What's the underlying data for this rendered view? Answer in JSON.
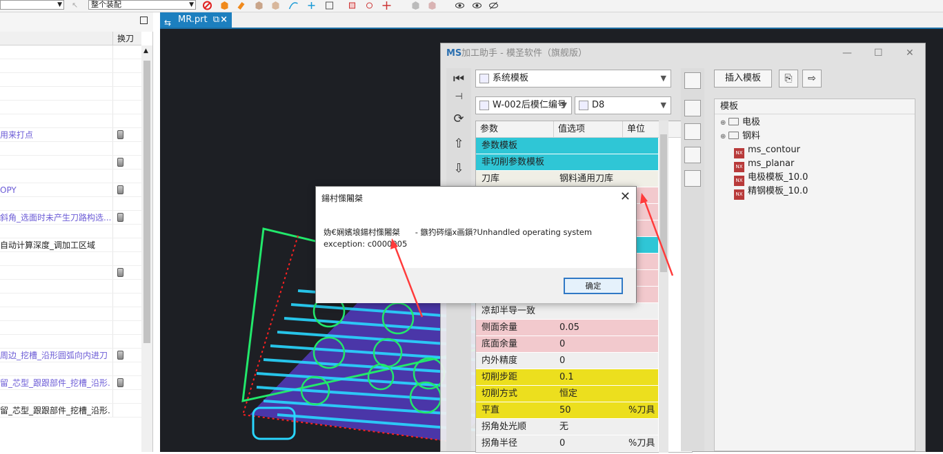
{
  "toolbar": {
    "filter_value": "",
    "scope_value": "整个装配",
    "accent_color": "#1c7fbf"
  },
  "left_panel": {
    "column_tool": "换刀",
    "rows": [
      {
        "text": "",
        "color": "default",
        "tool": false
      },
      {
        "text": "",
        "color": "default",
        "tool": false
      },
      {
        "text": "",
        "color": "default",
        "tool": false
      },
      {
        "text": "",
        "color": "default",
        "tool": false
      },
      {
        "text": "",
        "color": "default",
        "tool": false
      },
      {
        "text": "",
        "color": "default",
        "tool": false
      },
      {
        "text": "用来打点",
        "color": "purple",
        "tool": true
      },
      {
        "text": "",
        "color": "default",
        "tool": false
      },
      {
        "text": "",
        "color": "default",
        "tool": true
      },
      {
        "text": "",
        "color": "default",
        "tool": false
      },
      {
        "text": "OPY",
        "color": "purple",
        "tool": true
      },
      {
        "text": "",
        "color": "default",
        "tool": false
      },
      {
        "text": "斜角_选面时未产生刀路构选...",
        "color": "purple",
        "tool": true
      },
      {
        "text": "",
        "color": "default",
        "tool": false
      },
      {
        "text": "自动计算深度_调加工区域",
        "color": "default",
        "tool": false
      },
      {
        "text": "",
        "color": "default",
        "tool": false
      },
      {
        "text": "",
        "color": "default",
        "tool": true
      },
      {
        "text": "",
        "color": "default",
        "tool": false
      },
      {
        "text": "",
        "color": "default",
        "tool": false
      },
      {
        "text": "",
        "color": "default",
        "tool": false
      },
      {
        "text": "",
        "color": "default",
        "tool": false
      },
      {
        "text": "",
        "color": "default",
        "tool": false
      },
      {
        "text": "周边_挖槽_沿形圆弧向内进刀",
        "color": "purple",
        "tool": true
      },
      {
        "text": "",
        "color": "default",
        "tool": false
      },
      {
        "text": "留_芯型_跟跟部件_挖槽_沿形...",
        "color": "purple",
        "tool": true
      },
      {
        "text": "",
        "color": "default",
        "tool": false
      },
      {
        "text": "留_芯型_跟跟部件_挖槽_沿形...",
        "color": "default",
        "tool": false
      }
    ]
  },
  "doc_tab": {
    "label": "MR.prt",
    "close": "×"
  },
  "assistant": {
    "title": "加工助手 - 模圣软件（旗舰版）",
    "controls": [
      "—",
      "☐",
      "✕"
    ],
    "template_combo": "系统模板",
    "part_combo": "W-002后模仁编号",
    "tool_combo": "D8",
    "insert_button": "插入模板",
    "table_headers": [
      "参数",
      "值选项",
      "单位"
    ],
    "params": [
      {
        "name": "参数模板",
        "value": "",
        "unit": "",
        "bg": "#2fc6d6"
      },
      {
        "name": "非切削参数模板",
        "value": "",
        "unit": "",
        "bg": "#2fc6d6"
      },
      {
        "name": "刀库",
        "value": "钢料通用刀库",
        "unit": "",
        "bg": "#f0efe6"
      },
      {
        "name": "",
        "value": "",
        "unit": "",
        "bg": "#f2c9cd"
      },
      {
        "name": "",
        "value": "",
        "unit": "",
        "bg": "#f2c9cd"
      },
      {
        "name": "",
        "value": "",
        "unit": "",
        "bg": "#f2c9cd"
      },
      {
        "name": "",
        "value": "",
        "unit": "",
        "bg": "#2fc6d6"
      },
      {
        "name": "",
        "value": "",
        "unit": "",
        "bg": "#f2c9cd"
      },
      {
        "name": "",
        "value": "",
        "unit": "",
        "bg": "#f2c9cd"
      },
      {
        "name": "",
        "value": "",
        "unit": "",
        "bg": "#f2c9cd"
      },
      {
        "name": "凉却半导一致",
        "value": "",
        "unit": "",
        "bg": "#efefef"
      },
      {
        "name": "侧面余量",
        "value": "0.05",
        "unit": "",
        "bg": "#f2c9cd"
      },
      {
        "name": "底面余量",
        "value": "0",
        "unit": "",
        "bg": "#f2c9cd"
      },
      {
        "name": "内外精度",
        "value": "0",
        "unit": "",
        "bg": "#efefef"
      },
      {
        "name": "切削步距",
        "value": "0.1",
        "unit": "",
        "bg": "#ecdf1e"
      },
      {
        "name": "切削方式",
        "value": "恒定",
        "unit": "",
        "bg": "#ecdf1e"
      },
      {
        "name": "平直",
        "value": "50",
        "unit": "%刀具",
        "bg": "#ecdf1e"
      },
      {
        "name": "拐角处光顺",
        "value": "无",
        "unit": "",
        "bg": "#efefef"
      },
      {
        "name": "拐角半径",
        "value": "0",
        "unit": "%刀具",
        "bg": "#efefef"
      }
    ],
    "tree_header": "模板",
    "tree": [
      {
        "label": "电极",
        "type": "folder",
        "level": 0
      },
      {
        "label": "钢料",
        "type": "folder",
        "level": 0
      },
      {
        "label": "ms_contour",
        "type": "nx",
        "level": 1
      },
      {
        "label": "ms_planar",
        "type": "nx",
        "level": 1
      },
      {
        "label": "电极模板_10.0",
        "type": "nx",
        "level": 1
      },
      {
        "label": "精钢模板_10.0",
        "type": "nx",
        "level": 1
      }
    ]
  },
  "dialog": {
    "title": "鍚村憡闂桀",
    "message": "妫€娴嬪埌鍚村憡闂桀      - 鏃犳硶缁х画鎻?Unhandled operating system exception: c0000005",
    "ok_label": "确定",
    "close": "✕"
  },
  "colors": {
    "viewport_bg": "#1d1f24",
    "toolpath": "#29d6ff",
    "part": "#6a4bd6",
    "arrow": "#ff3333"
  }
}
